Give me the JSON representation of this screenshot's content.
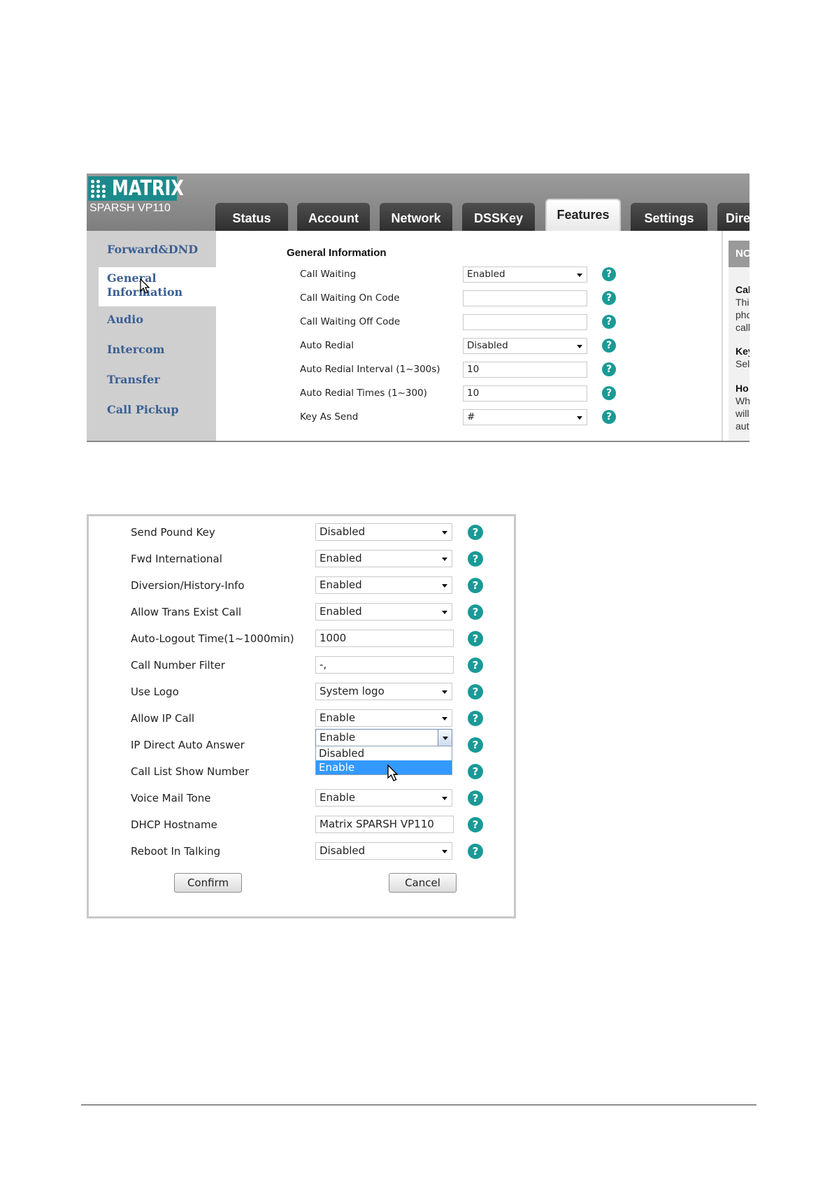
{
  "shot1": {
    "brand": "MATRIX",
    "model": "SPARSH VP110",
    "tabs": [
      {
        "label": "Status",
        "active": false
      },
      {
        "label": "Account",
        "active": false
      },
      {
        "label": "Network",
        "active": false
      },
      {
        "label": "DSSKey",
        "active": false
      },
      {
        "label": "Features",
        "active": true
      },
      {
        "label": "Settings",
        "active": false
      },
      {
        "label": "Dire",
        "active": false
      }
    ],
    "sidebar": [
      {
        "label": "Forward&DND",
        "active": false
      },
      {
        "label": "General",
        "label2": "Information",
        "active": true
      },
      {
        "label": "Audio",
        "active": false
      },
      {
        "label": "Intercom",
        "active": false
      },
      {
        "label": "Transfer",
        "active": false
      },
      {
        "label": "Call Pickup",
        "active": false
      }
    ],
    "section_title": "General Information",
    "fields": [
      {
        "label": "Call Waiting",
        "type": "select",
        "value": "Enabled"
      },
      {
        "label": "Call Waiting On Code",
        "type": "input",
        "value": ""
      },
      {
        "label": "Call Waiting Off Code",
        "type": "input",
        "value": ""
      },
      {
        "label": "Auto Redial",
        "type": "select",
        "value": "Disabled"
      },
      {
        "label": "Auto Redial Interval (1~300s)",
        "type": "input",
        "value": "10"
      },
      {
        "label": "Auto Redial Times (1~300)",
        "type": "input",
        "value": "10"
      },
      {
        "label": "Key As Send",
        "type": "select",
        "value": "#"
      }
    ],
    "note": {
      "header": "NO",
      "lines": [
        {
          "text": "Cal",
          "bold": true
        },
        {
          "text": "Thi",
          "bold": false
        },
        {
          "text": "pho",
          "bold": false
        },
        {
          "text": "call",
          "bold": false
        },
        {
          "text": "Key",
          "bold": true
        },
        {
          "text": "Sel",
          "bold": false
        },
        {
          "text": "Ho",
          "bold": true
        },
        {
          "text": "Wh",
          "bold": false
        },
        {
          "text": "will",
          "bold": false
        },
        {
          "text": "aut",
          "bold": false
        }
      ]
    }
  },
  "shot2": {
    "fields": [
      {
        "label": "Send Pound Key",
        "type": "select",
        "value": "Disabled"
      },
      {
        "label": "Fwd International",
        "type": "select",
        "value": "Enabled"
      },
      {
        "label": "Diversion/History-Info",
        "type": "select",
        "value": "Enabled"
      },
      {
        "label": "Allow Trans Exist Call",
        "type": "select",
        "value": "Enabled"
      },
      {
        "label": "Auto-Logout Time(1~1000min)",
        "type": "input",
        "value": "1000"
      },
      {
        "label": "Call Number Filter",
        "type": "input",
        "value": "-,"
      },
      {
        "label": "Use Logo",
        "type": "select",
        "value": "System logo"
      },
      {
        "label": "Allow IP Call",
        "type": "select",
        "value": "Enable"
      },
      {
        "label": "IP Direct Auto Answer",
        "type": "select-open",
        "value": "Enable"
      },
      {
        "label": "Call List Show Number",
        "type": "select",
        "value": ""
      },
      {
        "label": "Voice Mail Tone",
        "type": "select",
        "value": "Enable"
      },
      {
        "label": "DHCP Hostname",
        "type": "input",
        "value": "Matrix SPARSH VP110"
      },
      {
        "label": "Reboot In Talking",
        "type": "select",
        "value": "Disabled"
      }
    ],
    "dropdown_options": [
      {
        "label": "Disabled",
        "selected": false
      },
      {
        "label": "Enable",
        "selected": true
      }
    ],
    "confirm_label": "Confirm",
    "cancel_label": "Cancel"
  },
  "help_glyph": "?",
  "colors": {
    "accent": "#1a9a96",
    "tab_dark": "#3a3a3a",
    "side_link": "#3c5f93",
    "highlight": "#3399ff"
  }
}
